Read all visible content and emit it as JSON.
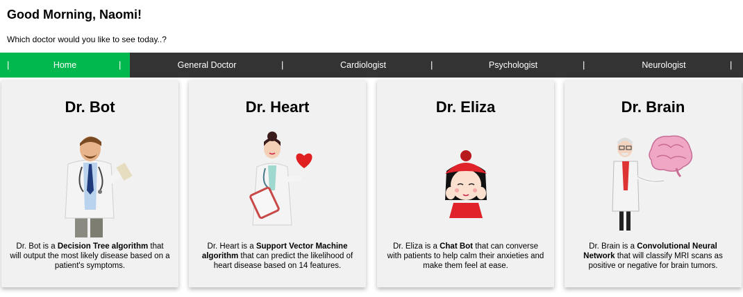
{
  "header": {
    "greeting": "Good Morning, Naomi!",
    "subtitle": "Which doctor would you like to see today..?"
  },
  "nav": {
    "items": [
      {
        "label": "Home",
        "active": true
      },
      {
        "label": "General Doctor",
        "active": false
      },
      {
        "label": "Cardiologist",
        "active": false
      },
      {
        "label": "Psychologist",
        "active": false
      },
      {
        "label": "Neurologist",
        "active": false
      }
    ],
    "separator": "|",
    "active_color": "#00b84d",
    "bar_color": "#333333"
  },
  "doctors": [
    {
      "name": "Dr. Bot",
      "icon": "male-doctor-illustration",
      "desc_pre": "Dr. Bot is a ",
      "desc_bold": "Decision Tree algorithm",
      "desc_post": " that will output the most likely disease based on a patient's symptoms."
    },
    {
      "name": "Dr. Heart",
      "icon": "female-doctor-heart-illustration",
      "desc_pre": "Dr. Heart is a ",
      "desc_bold": "Support Vector Machine algorithm",
      "desc_post": " that can predict the likelihood of heart disease based on 14 features."
    },
    {
      "name": "Dr. Eliza",
      "icon": "girl-red-hat-illustration",
      "desc_pre": "Dr. Eliza is a ",
      "desc_bold": "Chat Bot",
      "desc_post": " that can converse with patients to help calm their anxieties and make them feel at ease."
    },
    {
      "name": "Dr. Brain",
      "icon": "old-doctor-brain-illustration",
      "desc_pre": "Dr. Brain is a ",
      "desc_bold": "Convolutional Neural Network",
      "desc_post": " that will classify MRI scans as positive or negative for brain tumors."
    }
  ]
}
